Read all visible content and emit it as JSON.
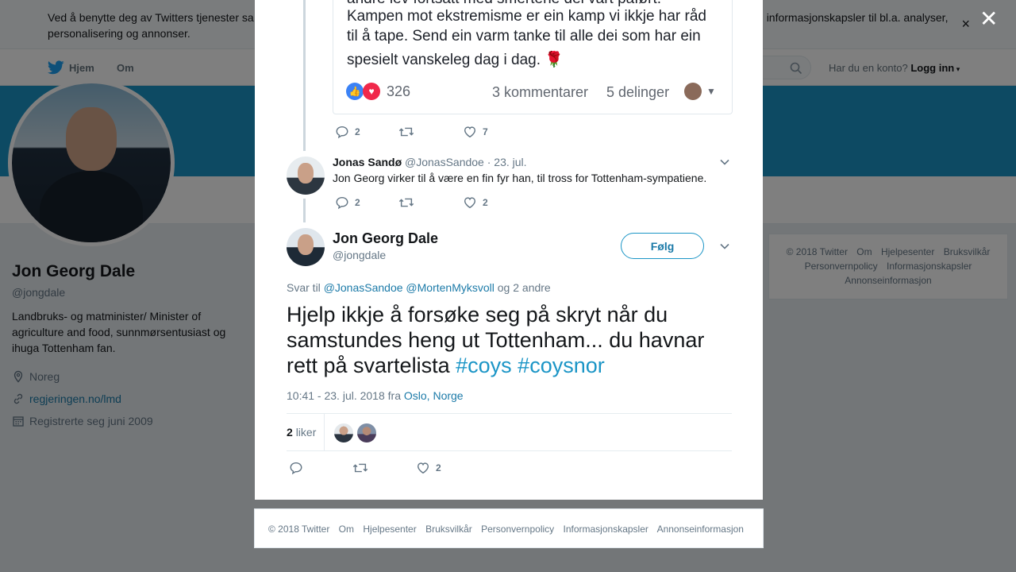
{
  "cookie_bar": {
    "text_start": "Ved å benytte deg av Twitters tjenester sa",
    "text_end": "informasjonskapsler til bl.a. analyser,",
    "text_line2": "personalisering og annonser.",
    "close": "×"
  },
  "nav": {
    "home": "Hjem",
    "about": "Om",
    "account_prompt": "Har du en konto?",
    "login": "Logg inn"
  },
  "profile": {
    "name": "Jon Georg Dale",
    "handle": "@jongdale",
    "bio": "Landbruks- og matminister/ Minister of agriculture and food, sunnmørsentusiast og ihuga Tottenham fan.",
    "location": "Noreg",
    "website": "regjeringen.no/lmd",
    "joined": "Registrerte seg juni 2009"
  },
  "footer_right": [
    "© 2018 Twitter",
    "Om",
    "Hjelpesenter",
    "Bruksvilkår",
    "Personvernpolicy",
    "Informasjonskapsler",
    "Annonseinformasjon"
  ],
  "overlay": {
    "close": "✕"
  },
  "embedded_image": {
    "lines": [
      "andre lev fortsatt med smertene dei vart påført.",
      "Kampen mot ekstremisme er ein kamp vi ikkje har råd",
      "til å tape. Send ein varm tanke til alle dei som har ein",
      "spesielt vanskeleg dag i dag. 🌹"
    ],
    "reaction_count": "326",
    "comments": "3 kommentarer",
    "shares": "5 delinger"
  },
  "first_tweet_actions": {
    "replies": "2",
    "likes": "7"
  },
  "reply_tweet": {
    "name": "Jonas Sandø",
    "handle": "@JonasSandoe",
    "date": "· 23. jul.",
    "text": "Jon Georg virker til å være en fin fyr han, til tross for Tottenham-sympatiene.",
    "replies": "2",
    "likes": "2"
  },
  "main_tweet": {
    "name": "Jon Georg Dale",
    "handle": "@jongdale",
    "follow": "Følg",
    "reply_to_prefix": "Svar til",
    "reply_to_1": "@JonasSandoe",
    "reply_to_2": "@MortenMyksvoll",
    "reply_to_suffix": "og 2 andre",
    "text": "Hjelp ikkje å forsøke seg på skryt når du samstundes heng ut Tottenham... du havnar rett på svartelista",
    "hashtag_1": "#coys",
    "hashtag_2": "#coysnor",
    "timestamp": "10:41 - 23. jul. 2018 fra",
    "place": "Oslo, Norge",
    "like_count": "2",
    "like_label": "liker",
    "likes": "2"
  },
  "modal_footer": [
    "© 2018 Twitter",
    "Om",
    "Hjelpesenter",
    "Bruksvilkår",
    "Personvernpolicy",
    "Informasjonskapsler",
    "Annonseinformasjon"
  ],
  "colors": {
    "accent": "#1b95c6",
    "link": "#1b7aa8",
    "overlay": "rgba(0,0,0,0.5)"
  }
}
